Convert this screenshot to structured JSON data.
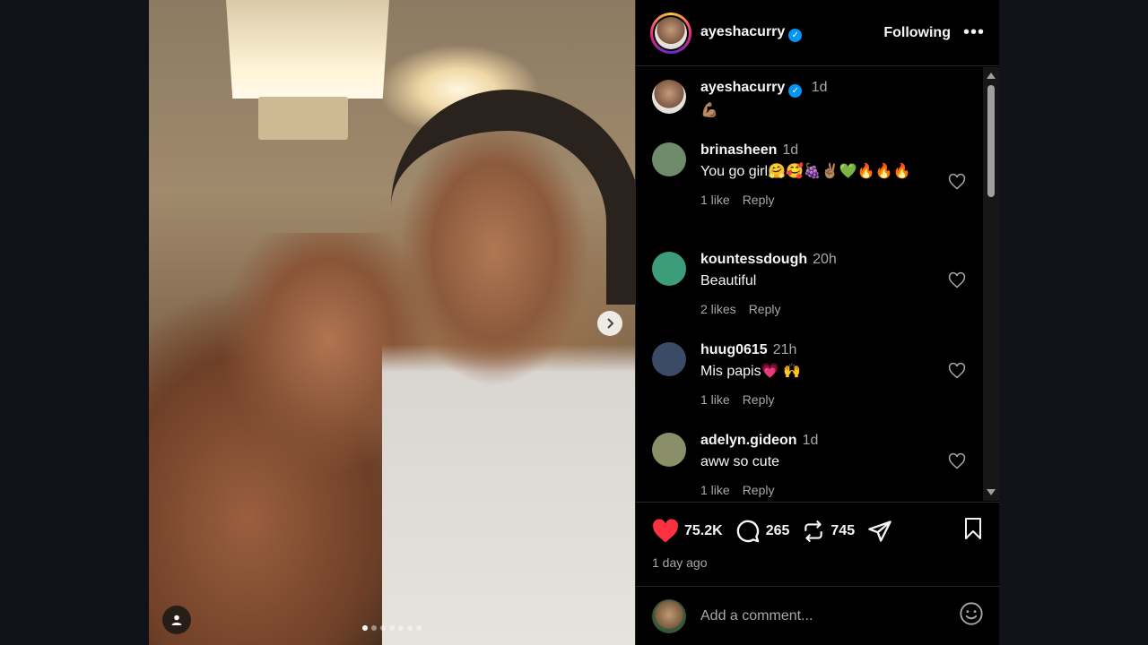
{
  "post": {
    "photo_alt": "selfie",
    "carousel": {
      "count": 7,
      "active_index": 0
    }
  },
  "header": {
    "username": "ayeshacurry",
    "follow_label": "Following",
    "more_icon": "more-horizontal-icon"
  },
  "caption": {
    "username": "ayeshacurry",
    "time": "1d",
    "text": "💪🏽"
  },
  "comments": [
    {
      "username": "brinasheen",
      "time": "1d",
      "text": "You go girl🤗🥰🍇✌🏽💚🔥🔥🔥",
      "likes": "1 like",
      "reply": "Reply",
      "avatar_color": "#6f8c6a"
    },
    {
      "username": "kountessdough",
      "time": "20h",
      "text": "Beautiful",
      "likes": "2 likes",
      "reply": "Reply",
      "avatar_color": "#3c9d7a"
    },
    {
      "username": "huug0615",
      "time": "21h",
      "text": "Mis papis💗 🙌",
      "likes": "1 like",
      "reply": "Reply",
      "avatar_color": "#3b4a66"
    },
    {
      "username": "adelyn.gideon",
      "time": "1d",
      "text": "aww so cute",
      "likes": "1 like",
      "reply": "Reply",
      "avatar_color": "#8a8f6a"
    }
  ],
  "stats": {
    "likes": "75.2K",
    "comments": "265",
    "reposts": "745",
    "posted": "1 day ago",
    "like_color": "#ff3040"
  },
  "composer": {
    "placeholder": "Add a comment..."
  }
}
